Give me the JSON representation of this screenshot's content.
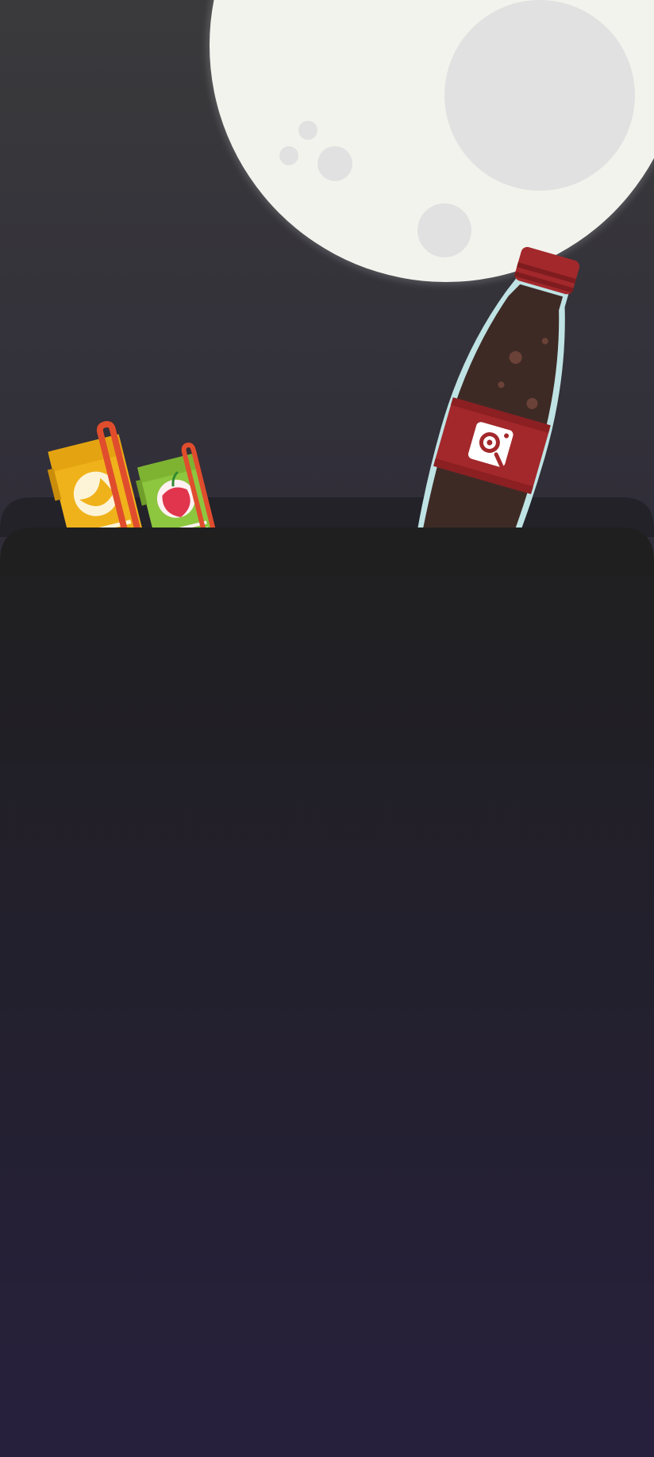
{
  "colors": {
    "background_top": "#3a3a3c",
    "background_bottom": "#29203f",
    "moon": "#f3f3ee",
    "moon_crater": "#e0e0e0",
    "front_panel_top": "#1f1f1f",
    "front_panel_bottom": "#27203d",
    "back_panel": "#232229",
    "bottle_liquid": "#3e2a25",
    "bottle_label": "#a3282b",
    "bottle_glass": "#bfe3e4",
    "juice_orange": "#f0b21b",
    "juice_apple": "#8dc63f",
    "straw": "#e04d2d"
  },
  "icons": {
    "moon": "moon-illustration",
    "bottle": "soda-bottle-illustration",
    "orange_box": "orange-juice-box-icon",
    "apple_box": "apple-juice-box-icon",
    "brand_logo": "magnifier-logo-icon"
  }
}
